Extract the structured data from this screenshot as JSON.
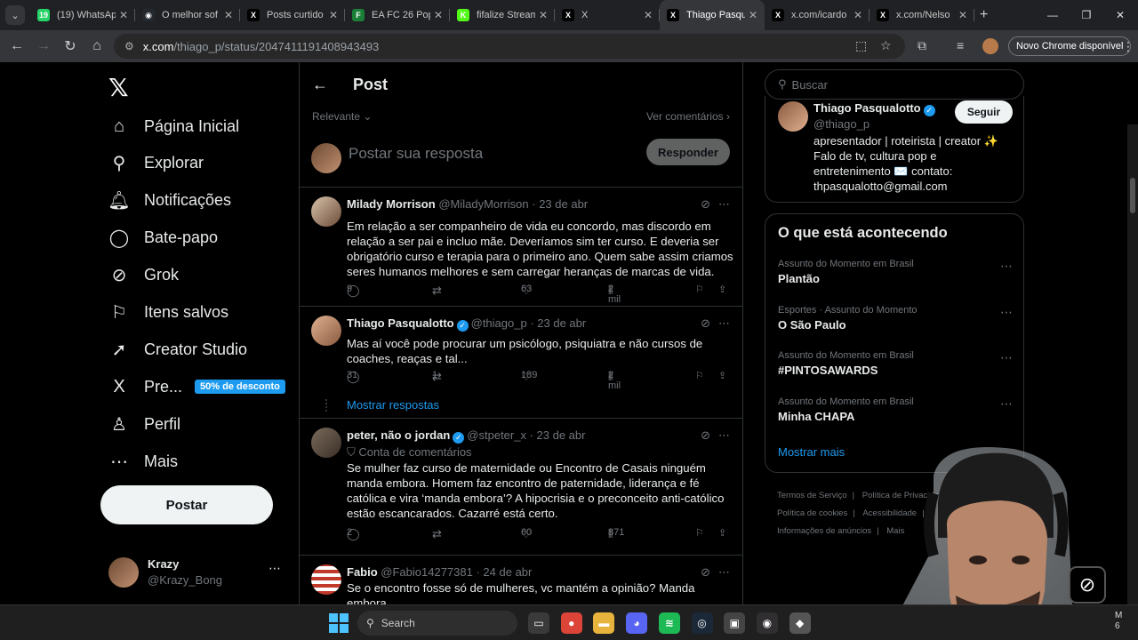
{
  "browser": {
    "tabs": [
      {
        "title": "(19) WhatsApp",
        "icon": "whatsapp-icon",
        "color": "#25d366",
        "glyph": "19"
      },
      {
        "title": "O melhor sof",
        "icon": "github-icon",
        "color": "#24292f",
        "glyph": "◉"
      },
      {
        "title": "Posts curtido",
        "icon": "x-icon",
        "color": "#000000",
        "glyph": "X"
      },
      {
        "title": "EA FC 26 Pop",
        "icon": "futbin-icon",
        "color": "#1a7f37",
        "glyph": "F"
      },
      {
        "title": "fifalize Stream",
        "icon": "kick-icon",
        "color": "#53fc18",
        "glyph": "K"
      },
      {
        "title": "X",
        "icon": "x-icon",
        "color": "#000000",
        "glyph": "X"
      },
      {
        "title": "Thiago Pasqu",
        "icon": "x-icon",
        "color": "#000000",
        "glyph": "X",
        "active": true
      },
      {
        "title": "x.com/icardo",
        "icon": "x-icon",
        "color": "#000000",
        "glyph": "X"
      },
      {
        "title": "x.com/Nelso",
        "icon": "x-icon",
        "color": "#000000",
        "glyph": "X"
      }
    ],
    "url_domain": "x.com",
    "url_path": "/thiago_p/status/2047411191408943493",
    "update_label": "Novo Chrome disponível"
  },
  "nav": {
    "items": [
      {
        "label": "Página Inicial",
        "icon": "home-icon",
        "glyph": "⌂"
      },
      {
        "label": "Explorar",
        "icon": "search-icon",
        "glyph": "⚲"
      },
      {
        "label": "Notificações",
        "icon": "bell-icon",
        "glyph": "🔔︎"
      },
      {
        "label": "Bate-papo",
        "icon": "chat-icon",
        "glyph": "◯"
      },
      {
        "label": "Grok",
        "icon": "grok-icon",
        "glyph": "⊘"
      },
      {
        "label": "Itens salvos",
        "icon": "bookmark-icon",
        "glyph": "⚐"
      },
      {
        "label": "Creator Studio",
        "icon": "rocket-icon",
        "glyph": "➚"
      },
      {
        "label": "Pre...",
        "icon": "x-premium-icon",
        "glyph": "X"
      },
      {
        "label": "Perfil",
        "icon": "person-icon",
        "glyph": "♙"
      },
      {
        "label": "Mais",
        "icon": "more-icon",
        "glyph": "⋯"
      }
    ],
    "discount_badge": "50% de desconto",
    "post_button": "Postar",
    "account": {
      "name": "Krazy",
      "handle": "@Krazy_Bong"
    }
  },
  "main": {
    "title": "Post",
    "sort_label": "Relevante",
    "view_comments": "Ver comentários",
    "reply_placeholder": "Postar sua resposta",
    "reply_button": "Responder",
    "show_replies": "Mostrar respostas",
    "tweets": [
      {
        "name": "Milady Morrison",
        "handle": "@MiladyMorrison",
        "date": "· 23 de abr",
        "verified": false,
        "text": "Em relação a ser companheiro de vida eu concordo, mas discordo em relação a ser pai e incluo mãe. Deveríamos sim ter curso. E deveria ser obrigatório curso e terapia para o primeiro ano. Quem sabe assim criamos seres humanos melhores e sem carregar heranças de marcas de vida.",
        "replies": "9",
        "retweets": "",
        "likes": "63",
        "views": "2 mil"
      },
      {
        "name": "Thiago Pasqualotto",
        "handle": "@thiago_p",
        "date": "· 23 de abr",
        "verified": true,
        "text": "Mas aí você pode procurar um psicólogo, psiquiatra e não cursos de coaches, reaças e tal...",
        "replies": "31",
        "retweets": "1",
        "likes": "189",
        "views": "2 mil"
      },
      {
        "name": "peter, não o jordan",
        "handle": "@stpeter_x",
        "date": "· 23 de abr",
        "verified": true,
        "badge": "Conta de comentários",
        "text": "Se mulher faz curso de maternidade ou Encontro de Casais ninguém manda embora. Homem faz encontro de paternidade, liderança e fé católica e vira ‘manda embora’? A hipocrisia e o preconceito anti-católico estão escancarados. Cazarré está certo.",
        "replies": "2",
        "retweets": "",
        "likes": "60",
        "views": "871"
      },
      {
        "name": "Fabio",
        "handle": "@Fabio14277381",
        "date": "· 24 de abr",
        "verified": false,
        "text": "Se o encontro fosse só de mulheres, vc mantém a opinião? Manda embora"
      }
    ]
  },
  "right": {
    "search_placeholder": "Buscar",
    "profile": {
      "name": "Thiago Pasqualotto",
      "handle": "@thiago_p",
      "follow": "Seguir",
      "bio": "apresentador | roteirista | creator ✨ Falo de tv, cultura pop e entretenimento ✉️ contato: thpasqualotto@gmail.com"
    },
    "trends_title": "O que está acontecendo",
    "trends": [
      {
        "context": "Assunto do Momento em Brasil",
        "name": "Plantão"
      },
      {
        "context": "Esportes · Assunto do Momento",
        "name": "O São Paulo"
      },
      {
        "context": "Assunto do Momento em Brasil",
        "name": "#PINTOSAWARDS"
      },
      {
        "context": "Assunto do Momento em Brasil",
        "name": "Minha CHAPA"
      }
    ],
    "show_more": "Mostrar mais",
    "footer": [
      "Termos de Serviço",
      "Política de Privacidade",
      "Política de cookies",
      "Acessibilidade",
      "Informações de anúncios",
      "Mais"
    ]
  },
  "taskbar": {
    "search_label": "Search",
    "apps": [
      {
        "icon": "file-explorer-icon",
        "glyph": "▭",
        "color": "#3a3a3a"
      },
      {
        "icon": "chrome-icon",
        "glyph": "●",
        "color": "#db4437"
      },
      {
        "icon": "folder-icon",
        "glyph": "▬",
        "color": "#e8b33c"
      },
      {
        "icon": "discord-icon",
        "glyph": "◕",
        "color": "#5865f2"
      },
      {
        "icon": "spotify-icon",
        "glyph": "≋",
        "color": "#1db954"
      },
      {
        "icon": "steam-icon",
        "glyph": "◎",
        "color": "#1b2838"
      },
      {
        "icon": "app-icon",
        "glyph": "▣",
        "color": "#444"
      },
      {
        "icon": "obs-icon",
        "glyph": "◉",
        "color": "#302e31"
      },
      {
        "icon": "app-icon",
        "glyph": "◆",
        "color": "#555"
      }
    ]
  }
}
